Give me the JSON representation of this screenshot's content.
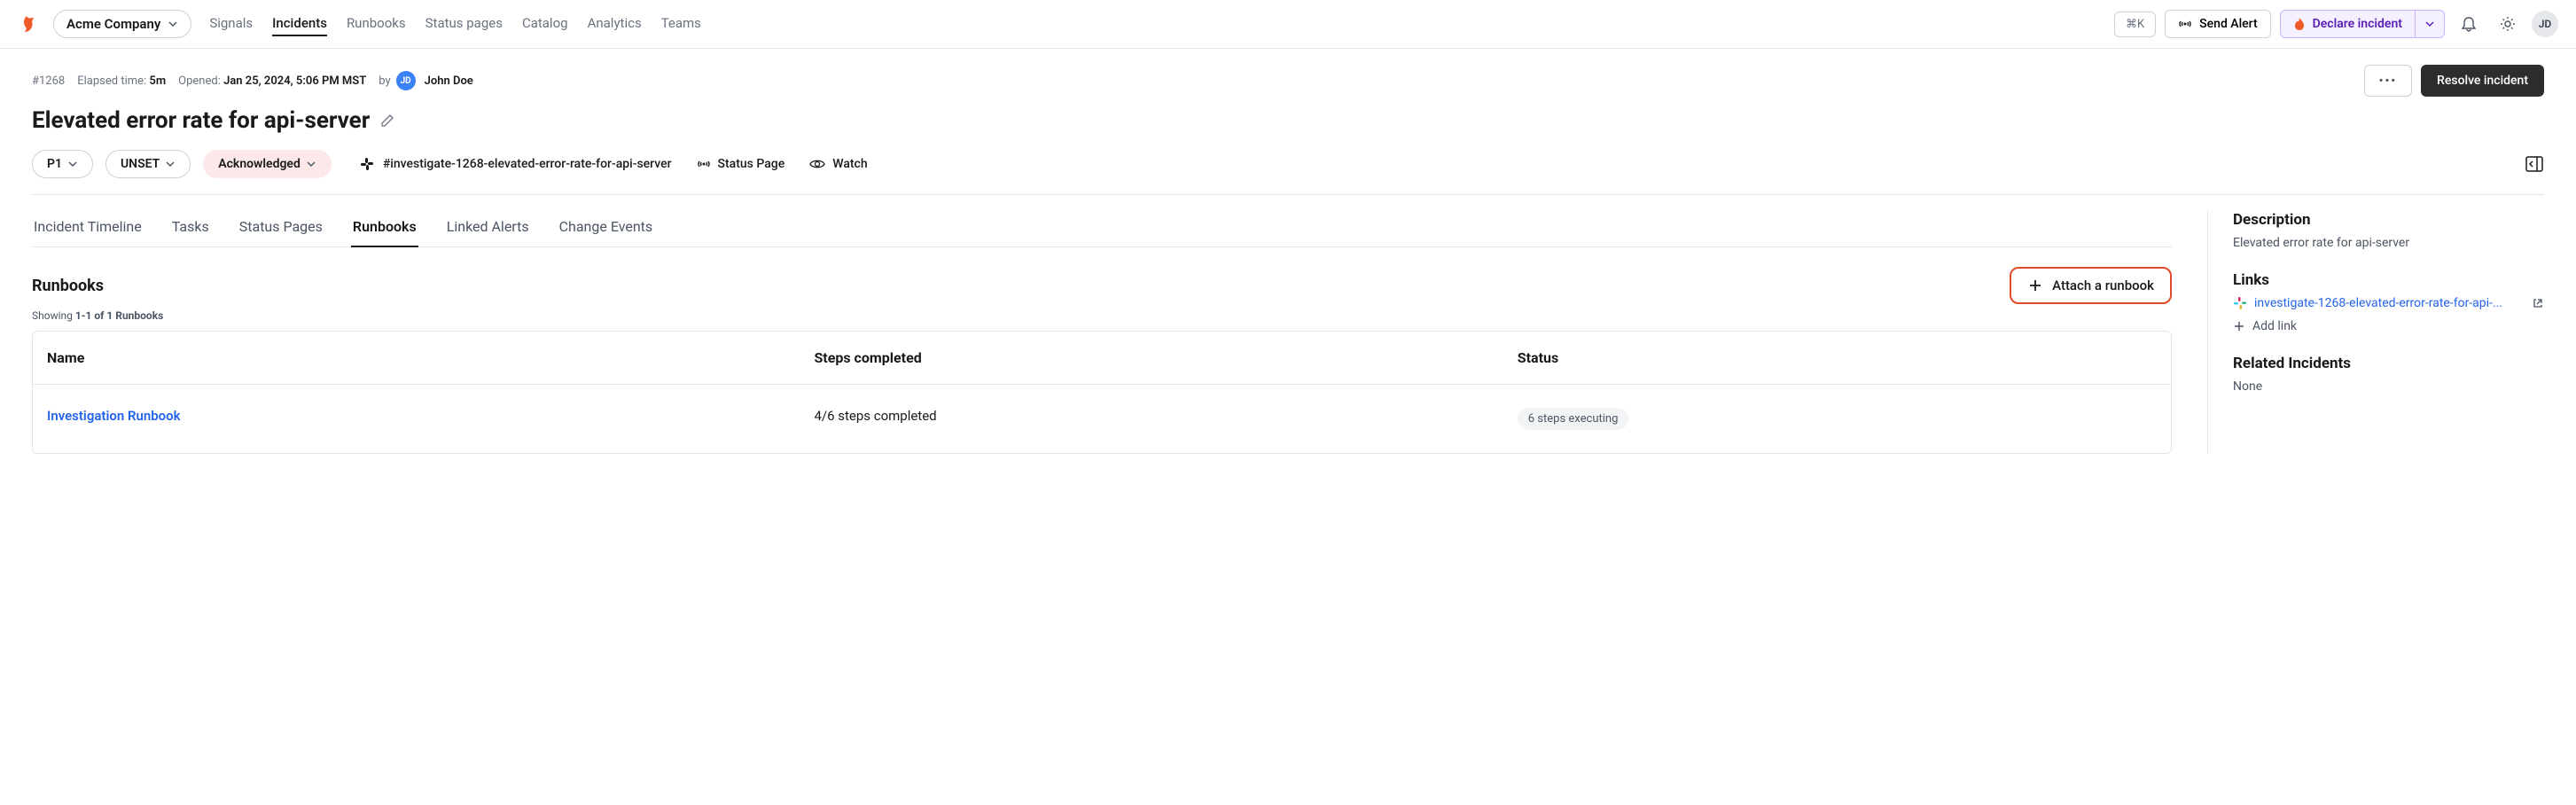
{
  "company": "Acme Company",
  "nav": {
    "signals": "Signals",
    "incidents": "Incidents",
    "runbooks": "Runbooks",
    "status_pages": "Status pages",
    "catalog": "Catalog",
    "analytics": "Analytics",
    "teams": "Teams"
  },
  "topbar": {
    "kbd": "⌘K",
    "send_alert": "Send Alert",
    "declare": "Declare incident",
    "avatar": "JD"
  },
  "incident": {
    "id": "#1268",
    "elapsed_label": "Elapsed time:",
    "elapsed_value": "5m",
    "opened_label": "Opened:",
    "opened_value": "Jan 25, 2024, 5:06 PM MST",
    "by_label": "by",
    "by_initials": "JD",
    "by_name": "John Doe",
    "title": "Elevated error rate for api-server",
    "more": "•••",
    "resolve": "Resolve incident",
    "priority": "P1",
    "unset": "UNSET",
    "ack": "Acknowledged",
    "slack_channel": "#investigate-1268-elevated-error-rate-for-api-server",
    "status_page": "Status Page",
    "watch": "Watch"
  },
  "tabs": {
    "timeline": "Incident Timeline",
    "tasks": "Tasks",
    "status_pages": "Status Pages",
    "runbooks": "Runbooks",
    "linked_alerts": "Linked Alerts",
    "change_events": "Change Events"
  },
  "runbooks": {
    "heading": "Runbooks",
    "attach": "Attach a runbook",
    "showing_prefix": "Showing ",
    "showing_range": "1-1 of 1 Runbooks",
    "col_name": "Name",
    "col_steps": "Steps completed",
    "col_status": "Status",
    "rows": [
      {
        "name": "Investigation Runbook",
        "steps": "4/6 steps completed",
        "status": "6 steps executing"
      }
    ]
  },
  "sidebar": {
    "description_heading": "Description",
    "description_text": "Elevated error rate for api-server",
    "links_heading": "Links",
    "slack_link": "investigate-1268-elevated-error-rate-for-api-...",
    "add_link": "Add link",
    "related_heading": "Related Incidents",
    "related_text": "None"
  }
}
